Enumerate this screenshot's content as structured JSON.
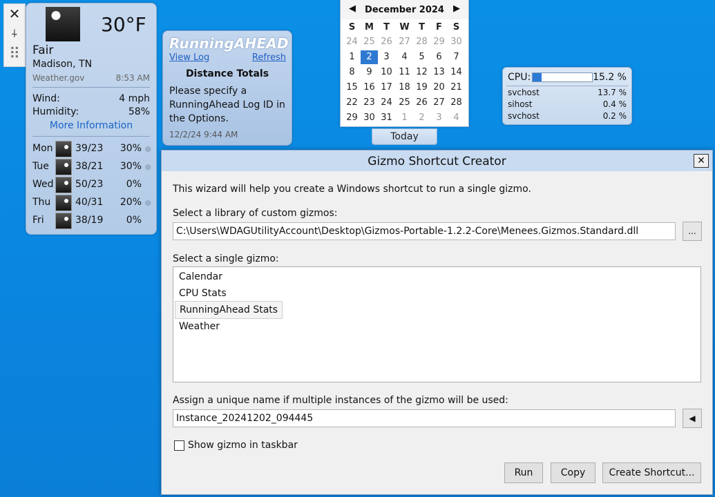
{
  "toolbar": {
    "close_glyph": "✕",
    "options_glyph": "⍭",
    "drag_glyph": "⠿"
  },
  "weather": {
    "temperature": "30°F",
    "condition": "Fair",
    "location": "Madison, TN",
    "source": "Weather.gov",
    "updated": "8:53 AM",
    "wind_label": "Wind:",
    "wind_value": "4 mph",
    "humidity_label": "Humidity:",
    "humidity_value": "58%",
    "more_info": "More Information",
    "forecast": [
      {
        "day": "Mon",
        "temps": "39/23",
        "precip": "30%",
        "icon": "clear-night-icon"
      },
      {
        "day": "Tue",
        "temps": "38/21",
        "precip": "30%",
        "icon": "rain-icon"
      },
      {
        "day": "Wed",
        "temps": "50/23",
        "precip": "0%",
        "icon": "partly-cloudy-icon"
      },
      {
        "day": "Thu",
        "temps": "40/31",
        "precip": "20%",
        "icon": "rain-icon"
      },
      {
        "day": "Fri",
        "temps": "38/19",
        "precip": "0%",
        "icon": "clear-night-icon"
      }
    ]
  },
  "running": {
    "logo": "RunningAHEAD",
    "view_log": "View Log",
    "refresh": "Refresh",
    "title": "Distance Totals",
    "message": "Please specify a RunningAhead Log ID in the Options.",
    "timestamp": "12/2/24 9:44 AM"
  },
  "calendar": {
    "month_label": "December 2024",
    "prev": "◀",
    "next": "▶",
    "weekdays": [
      "S",
      "M",
      "T",
      "W",
      "T",
      "F",
      "S"
    ],
    "weeks": [
      [
        "24",
        "25",
        "26",
        "27",
        "28",
        "29",
        "30"
      ],
      [
        "1",
        "2",
        "3",
        "4",
        "5",
        "6",
        "7"
      ],
      [
        "8",
        "9",
        "10",
        "11",
        "12",
        "13",
        "14"
      ],
      [
        "15",
        "16",
        "17",
        "18",
        "19",
        "20",
        "21"
      ],
      [
        "22",
        "23",
        "24",
        "25",
        "26",
        "27",
        "28"
      ],
      [
        "29",
        "30",
        "31",
        "1",
        "2",
        "3",
        "4"
      ]
    ],
    "selected_day": "2",
    "today_button": "Today"
  },
  "cpu": {
    "label": "CPU:",
    "usage_percent": 15.2,
    "usage_text": "15.2 %",
    "processes": [
      {
        "name": "svchost",
        "value": "13.7 %"
      },
      {
        "name": "sihost",
        "value": "0.4 %"
      },
      {
        "name": "svchost",
        "value": "0.2 %"
      }
    ]
  },
  "dialog": {
    "title": "Gizmo Shortcut Creator",
    "close_glyph": "✕",
    "intro": "This wizard will help you create a Windows shortcut to run a single gizmo.",
    "library_label": "Select a library of custom gizmos:",
    "library_path": "C:\\Users\\WDAGUtilityAccount\\Desktop\\Gizmos-Portable-1.2.2-Core\\Menees.Gizmos.Standard.dll",
    "browse_button": "...",
    "gizmo_label": "Select a single gizmo:",
    "gizmos": [
      "Calendar",
      "CPU Stats",
      "RunningAhead Stats",
      "Weather"
    ],
    "selected_gizmo": "RunningAhead Stats",
    "instance_label": "Assign a unique name if multiple instances of the gizmo will be used:",
    "instance_value": "Instance_20241202_094445",
    "instance_button": "◀",
    "taskbar_label": "Show gizmo in taskbar",
    "taskbar_checked": false,
    "run_button": "Run",
    "copy_button": "Copy",
    "create_button": "Create Shortcut..."
  }
}
